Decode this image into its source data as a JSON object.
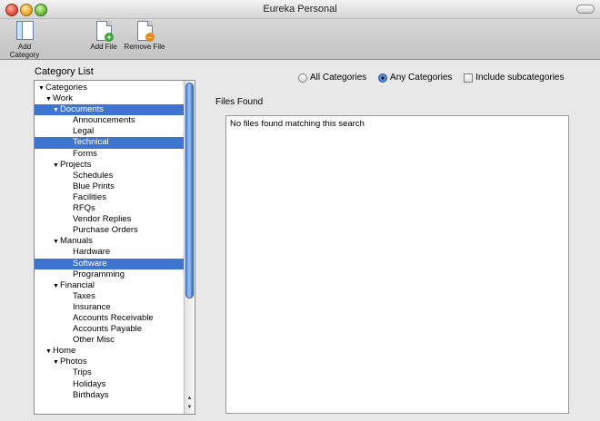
{
  "window": {
    "title": "Eureka Personal"
  },
  "toolbar": {
    "add_category": "Add Category",
    "add_file": "Add File",
    "remove_file": "Remove File"
  },
  "category_list": {
    "label": "Category List",
    "items": [
      {
        "label": "Categories",
        "level": 0,
        "expandable": true,
        "selected": false
      },
      {
        "label": "Work",
        "level": 1,
        "expandable": true,
        "selected": false
      },
      {
        "label": "Documents",
        "level": 2,
        "expandable": true,
        "selected": true
      },
      {
        "label": "Announcements",
        "level": 3,
        "expandable": false,
        "selected": false
      },
      {
        "label": "Legal",
        "level": 3,
        "expandable": false,
        "selected": false
      },
      {
        "label": "Technical",
        "level": 3,
        "expandable": false,
        "selected": true
      },
      {
        "label": "Forms",
        "level": 3,
        "expandable": false,
        "selected": false
      },
      {
        "label": "Projects",
        "level": 2,
        "expandable": true,
        "selected": false
      },
      {
        "label": "Schedules",
        "level": 3,
        "expandable": false,
        "selected": false
      },
      {
        "label": "Blue Prints",
        "level": 3,
        "expandable": false,
        "selected": false
      },
      {
        "label": "Facilities",
        "level": 3,
        "expandable": false,
        "selected": false
      },
      {
        "label": "RFQs",
        "level": 3,
        "expandable": false,
        "selected": false
      },
      {
        "label": "Vendor Replies",
        "level": 3,
        "expandable": false,
        "selected": false
      },
      {
        "label": "Purchase Orders",
        "level": 3,
        "expandable": false,
        "selected": false
      },
      {
        "label": "Manuals",
        "level": 2,
        "expandable": true,
        "selected": false
      },
      {
        "label": "Hardware",
        "level": 3,
        "expandable": false,
        "selected": false
      },
      {
        "label": "Software",
        "level": 3,
        "expandable": false,
        "selected": true
      },
      {
        "label": "Programming",
        "level": 3,
        "expandable": false,
        "selected": false
      },
      {
        "label": "Financial",
        "level": 2,
        "expandable": true,
        "selected": false
      },
      {
        "label": "Taxes",
        "level": 3,
        "expandable": false,
        "selected": false
      },
      {
        "label": "Insurance",
        "level": 3,
        "expandable": false,
        "selected": false
      },
      {
        "label": "Accounts Receivable",
        "level": 3,
        "expandable": false,
        "selected": false
      },
      {
        "label": "Accounts Payable",
        "level": 3,
        "expandable": false,
        "selected": false
      },
      {
        "label": "Other Misc",
        "level": 3,
        "expandable": false,
        "selected": false
      },
      {
        "label": "Home",
        "level": 1,
        "expandable": true,
        "selected": false
      },
      {
        "label": "Photos",
        "level": 2,
        "expandable": true,
        "selected": false
      },
      {
        "label": "Trips",
        "level": 3,
        "expandable": false,
        "selected": false
      },
      {
        "label": "Holidays",
        "level": 3,
        "expandable": false,
        "selected": false
      },
      {
        "label": "Birthdays",
        "level": 3,
        "expandable": false,
        "selected": false
      }
    ]
  },
  "search_options": {
    "all_categories": "All Categories",
    "any_categories": "Any Categories",
    "include_subcategories": "Include subcategories",
    "selected": "any_categories",
    "include_subcategories_checked": false
  },
  "files": {
    "label": "Files Found",
    "empty_message": "No files found matching this search"
  },
  "colors": {
    "selection": "#3d74cf"
  }
}
